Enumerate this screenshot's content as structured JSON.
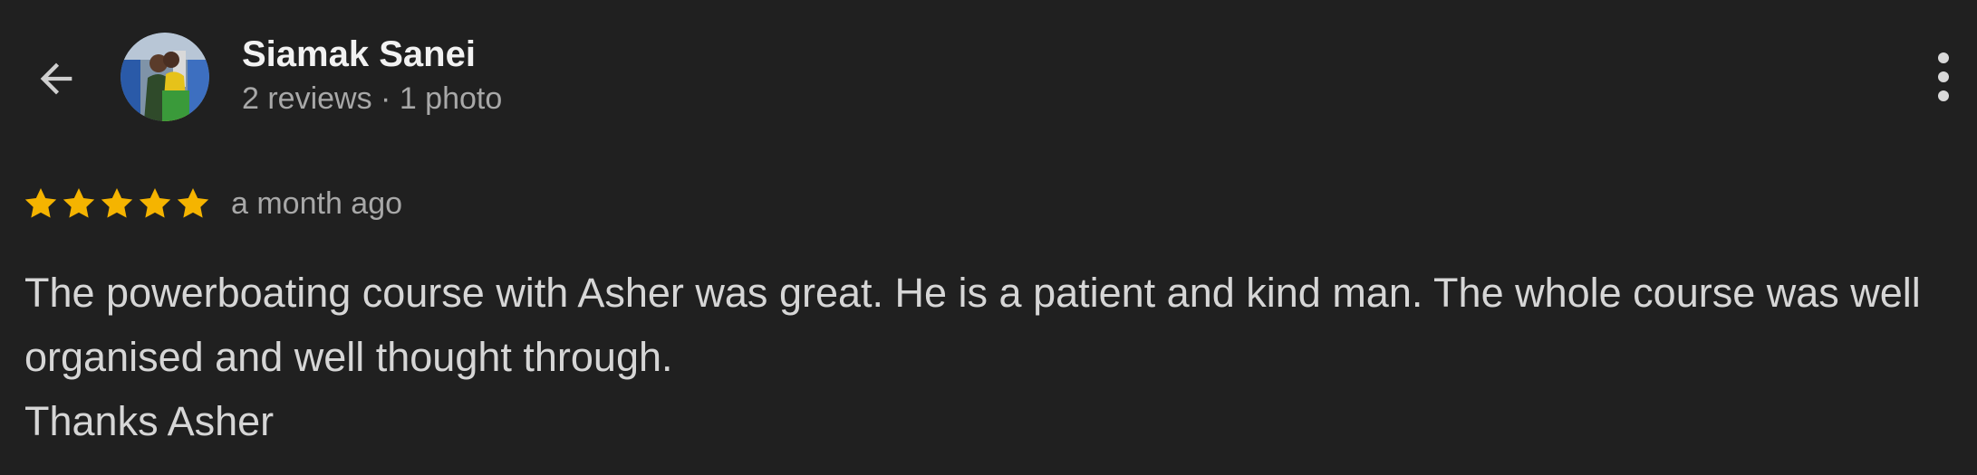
{
  "header": {
    "back_icon": "arrow-left-icon",
    "more_icon": "more-vertical-icon",
    "author": {
      "name": "Siamak Sanei",
      "meta": "2 reviews · 1 photo",
      "avatar_icon": "profile-photo"
    }
  },
  "review": {
    "rating": 5,
    "rating_max": 5,
    "star_color": "#f5b400",
    "time": "a month ago",
    "text_line1": "The powerboating course with Asher was great. He is a patient and kind man. The whole course was well organised and well thought through.",
    "text_line2": "Thanks Asher"
  },
  "colors": {
    "background": "#202020",
    "primary_text": "#f2f2f2",
    "secondary_text": "#a8a8a8",
    "body_text": "#d6d6d6"
  }
}
